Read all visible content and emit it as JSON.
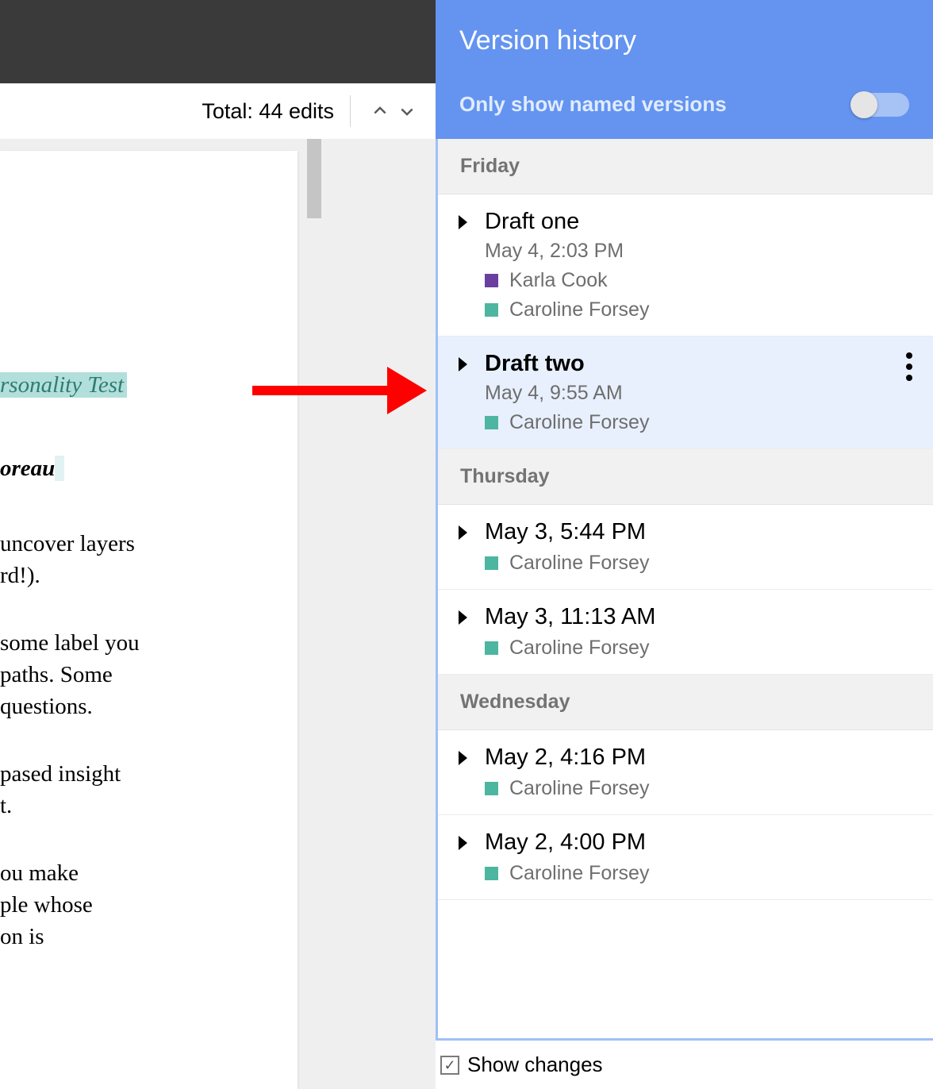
{
  "info_bar": {
    "total_text": "Total: 44 edits"
  },
  "document": {
    "hl_text": "rsonality Test",
    "author": "oreau",
    "line1": "uncover layers",
    "line2": "rd!).",
    "line3": " some label you",
    "line4": " paths. Some",
    "line5": "questions.",
    "line6": "pased insight",
    "line7": "t.",
    "line8": "ou make",
    "line9": "ple whose",
    "line10": "on is"
  },
  "sidebar": {
    "title": "Version history",
    "toggle_label": "Only show named versions",
    "show_changes": "Show changes",
    "groups": [
      {
        "day": "Friday",
        "versions": [
          {
            "title": "Draft one",
            "date": "May 4, 2:03 PM",
            "editors": [
              {
                "name": "Karla Cook",
                "color": "#6b3fa0"
              },
              {
                "name": "Caroline Forsey",
                "color": "#4db6a0"
              }
            ],
            "selected": false
          },
          {
            "title": "Draft two",
            "date": "May 4, 9:55 AM",
            "editors": [
              {
                "name": "Caroline Forsey",
                "color": "#4db6a0"
              }
            ],
            "selected": true
          }
        ]
      },
      {
        "day": "Thursday",
        "versions": [
          {
            "title": "May 3, 5:44 PM",
            "date": null,
            "editors": [
              {
                "name": "Caroline Forsey",
                "color": "#4db6a0"
              }
            ],
            "selected": false
          },
          {
            "title": "May 3, 11:13 AM",
            "date": null,
            "editors": [
              {
                "name": "Caroline Forsey",
                "color": "#4db6a0"
              }
            ],
            "selected": false
          }
        ]
      },
      {
        "day": "Wednesday",
        "versions": [
          {
            "title": "May 2, 4:16 PM",
            "date": null,
            "editors": [
              {
                "name": "Caroline Forsey",
                "color": "#4db6a0"
              }
            ],
            "selected": false
          },
          {
            "title": "May 2, 4:00 PM",
            "date": null,
            "editors": [
              {
                "name": "Caroline Forsey",
                "color": "#4db6a0"
              }
            ],
            "selected": false
          }
        ]
      }
    ]
  }
}
